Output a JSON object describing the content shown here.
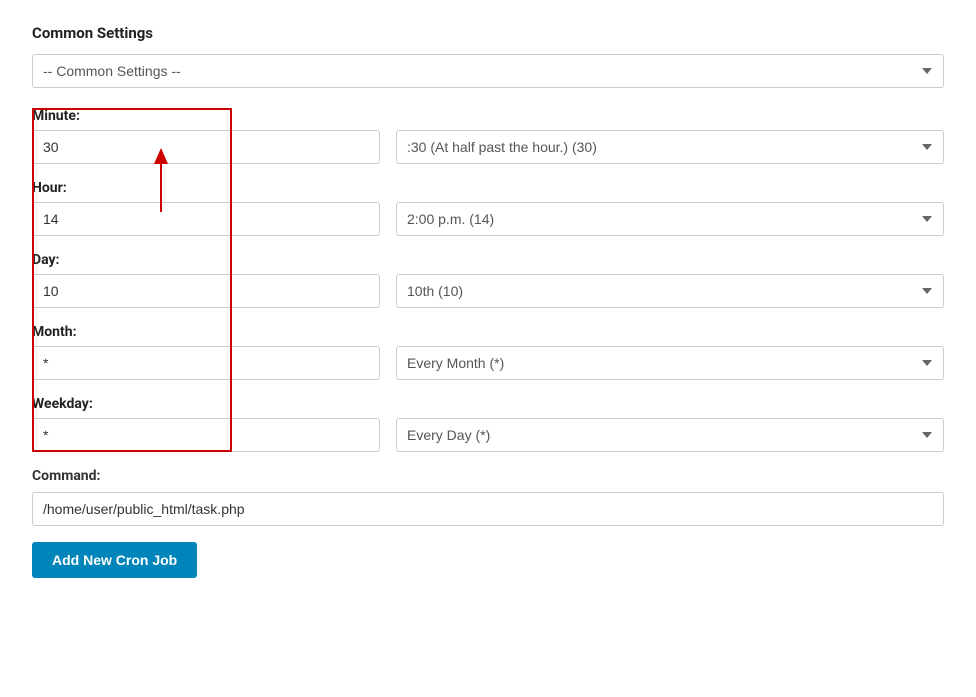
{
  "page": {
    "common_settings": {
      "section_label": "Common Settings",
      "dropdown_placeholder": "-- Common Settings --",
      "options": [
        "-- Common Settings --"
      ]
    },
    "fields": {
      "minute": {
        "label": "Minute:",
        "value": "30",
        "dropdown_value": ":30 (At half past the hour.) (30)",
        "dropdown_options": [
          ":30 (At half past the hour.) (30)"
        ]
      },
      "hour": {
        "label": "Hour:",
        "value": "14",
        "dropdown_value": "2:00 p.m. (14)",
        "dropdown_options": [
          "2:00 p.m. (14)"
        ]
      },
      "day": {
        "label": "Day:",
        "value": "10",
        "dropdown_value": "10th (10)",
        "dropdown_options": [
          "10th (10)"
        ]
      },
      "month": {
        "label": "Month:",
        "value": "*",
        "dropdown_value": "Every Month (*)",
        "dropdown_options": [
          "Every Month (*)"
        ]
      },
      "weekday": {
        "label": "Weekday:",
        "value": "*",
        "dropdown_value": "Every Day (*)",
        "dropdown_options": [
          "Every Day (*)"
        ]
      }
    },
    "command": {
      "label": "Command:",
      "value": "/home/user/public_html/task.php"
    },
    "add_button_label": "Add New Cron Job"
  }
}
